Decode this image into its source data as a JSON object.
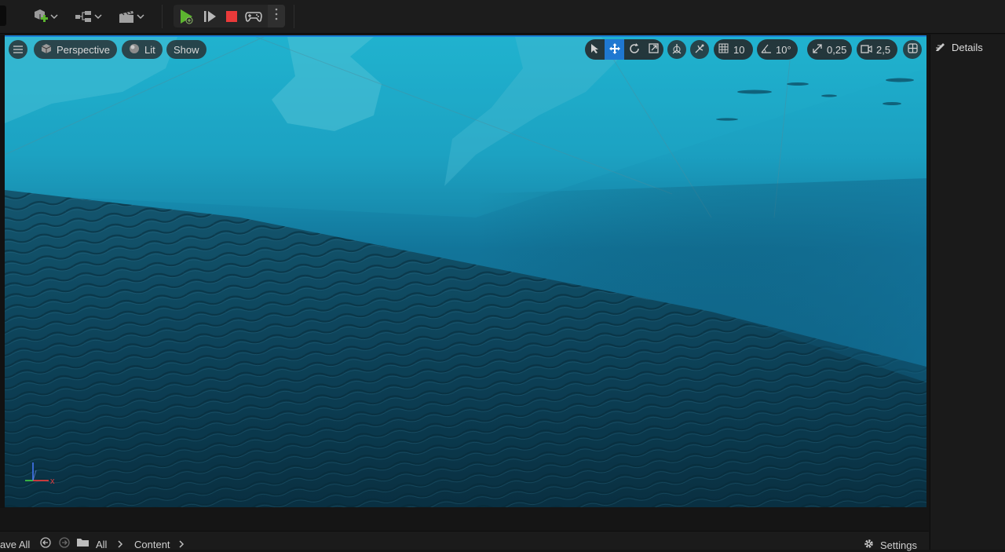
{
  "toolbar": {
    "icons": [
      "add-actor-icon",
      "blueprint-icon",
      "cinematics-icon",
      "play-icon",
      "advance-frame-icon",
      "stop-icon",
      "gamepad-icon",
      "more-vertical-icon"
    ],
    "colors": {
      "play": "#5cb52f",
      "stop": "#ea3a3a",
      "background": "#1c1c1c"
    }
  },
  "viewport": {
    "view_mode": "Perspective",
    "lighting_mode": "Lit",
    "show_label": "Show",
    "grid_snap": "10",
    "rotation_snap": "10°",
    "scale_snap": "0,25",
    "camera_speed": "2,5",
    "transform_tools": [
      "select-icon",
      "translate-icon",
      "rotate-icon",
      "scale-icon"
    ],
    "active_tool": "translate",
    "accent_color": "#1f78d1",
    "axis_labels": {
      "x": "x"
    }
  },
  "details": {
    "tab_label": "Details"
  },
  "content_browser": {
    "save_all": "ave All",
    "path": [
      "All",
      "Content"
    ],
    "settings_label": "Settings"
  }
}
